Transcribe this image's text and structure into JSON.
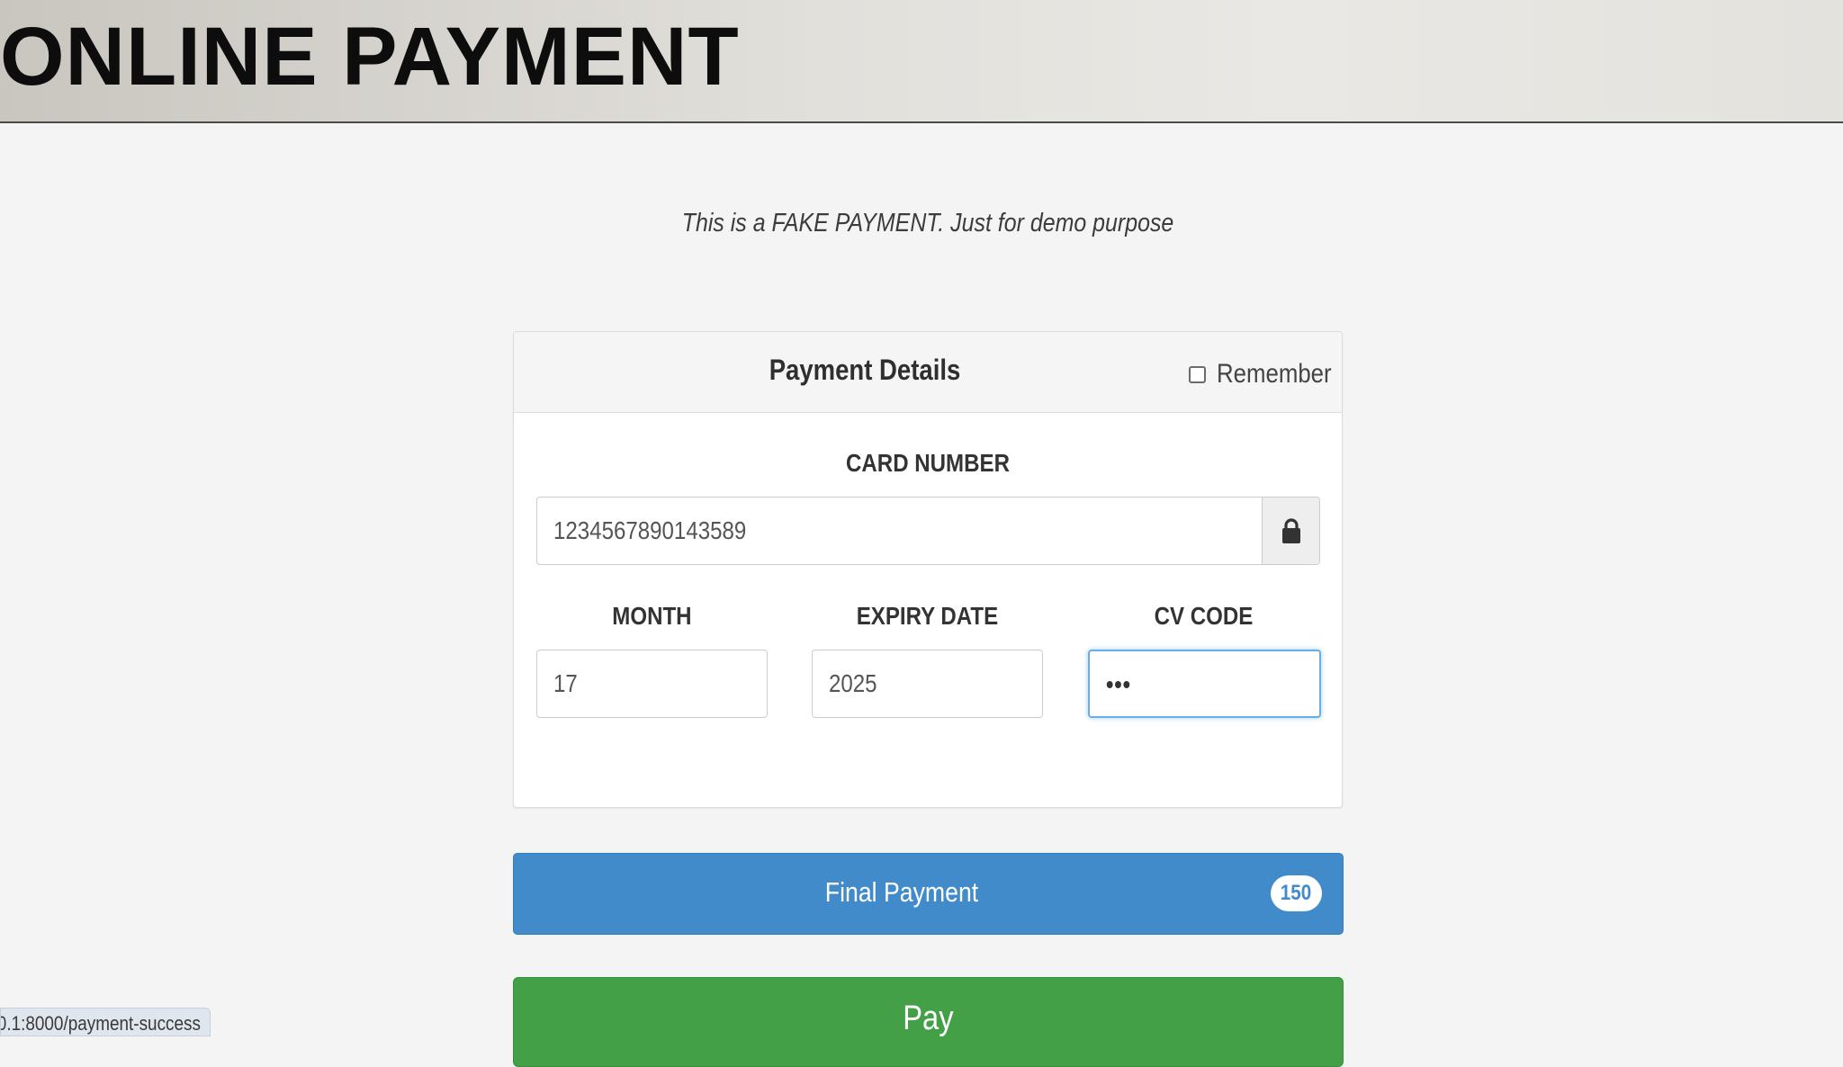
{
  "banner": {
    "title": "ONLINE PAYMENT"
  },
  "notice": {
    "text": "This is a FAKE PAYMENT. Just for demo purpose"
  },
  "panel": {
    "title": "Payment Details",
    "remember_label": "Remember",
    "remember_checked": false,
    "card_number_label": "CARD NUMBER",
    "card_number_value": "1234567890143589",
    "lock_icon": "lock-icon",
    "month_label": "MONTH",
    "month_value": "17",
    "expiry_label": "EXPIRY DATE",
    "expiry_value": "2025",
    "cv_label": "CV CODE",
    "cv_value": "•••"
  },
  "actions": {
    "final_payment_label": "Final Payment",
    "final_payment_badge": "150",
    "pay_label": "Pay"
  },
  "status_bar": {
    "url": "0.1:8000/payment-success"
  },
  "colors": {
    "primary": "#428bca",
    "success": "#43a047",
    "focus": "#66afe9"
  }
}
